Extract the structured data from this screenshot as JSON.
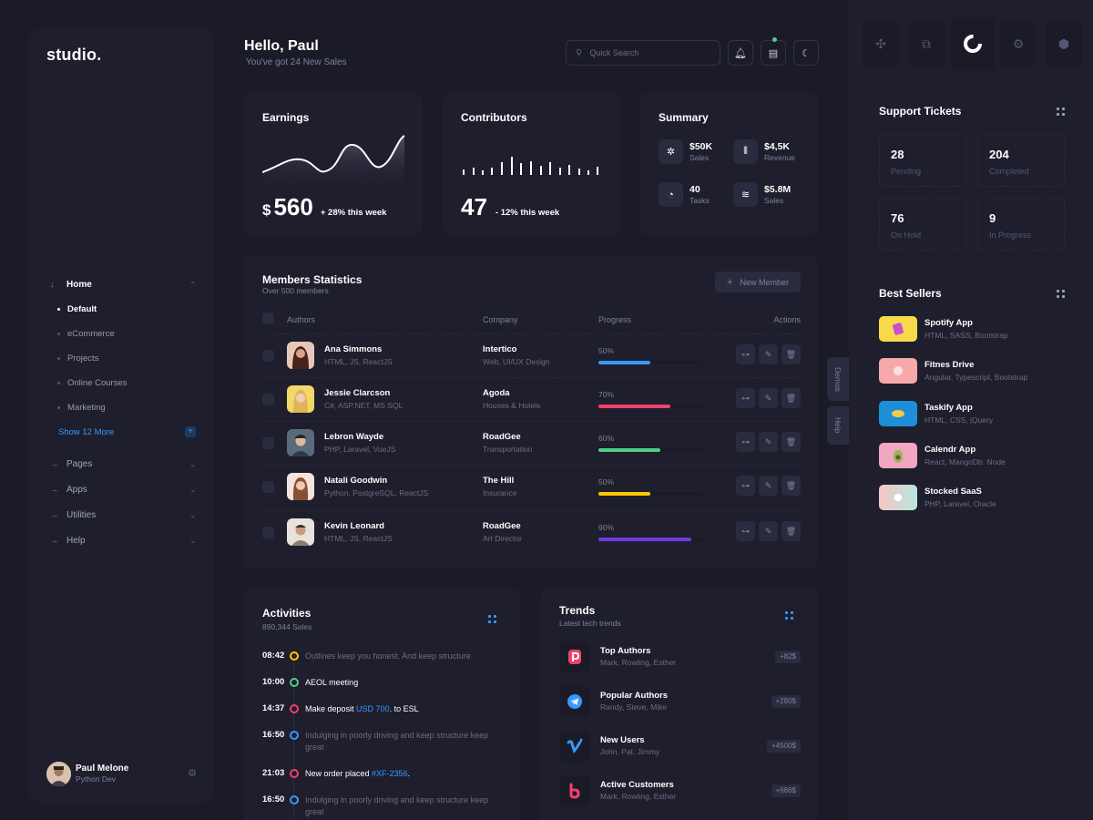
{
  "brand": {
    "logo": "studio."
  },
  "sidebar": {
    "home_label": "Home",
    "home_subitems": [
      "Default",
      "eCommerce",
      "Projects",
      "Online Courses",
      "Marketing"
    ],
    "show_more": "Show 12 More",
    "sections": [
      "Pages",
      "Apps",
      "Utilities",
      "Help"
    ],
    "user": {
      "name": "Paul Melone",
      "role": "Python Dev"
    }
  },
  "header": {
    "greeting": "Hello, Paul",
    "subtitle": "You've got 24 New Sales",
    "search_placeholder": "Quick Search"
  },
  "earnings": {
    "title": "Earnings",
    "currency": "$",
    "value": "560",
    "delta": "+ 28% this week"
  },
  "contributors": {
    "title": "Contributors",
    "value": "47",
    "delta": "- 12% this week"
  },
  "summary": {
    "title": "Summary",
    "items": [
      {
        "value": "$50K",
        "label": "Sales",
        "icon": "spinner-icon"
      },
      {
        "value": "$4,5K",
        "label": "Revenue",
        "icon": "bars-icon"
      },
      {
        "value": "40",
        "label": "Tasks",
        "icon": "refresh-icon"
      },
      {
        "value": "$5.8M",
        "label": "Sales",
        "icon": "stack-icon"
      }
    ]
  },
  "members": {
    "title": "Members Statistics",
    "subtitle": "Over 500 members",
    "new_button": "New Member",
    "columns": [
      "Authors",
      "Company",
      "Progress",
      "Actions"
    ],
    "rows": [
      {
        "name": "Ana Simmons",
        "skills": "HTML, JS, ReactJS",
        "company": "Intertico",
        "company_sub": "Web, UI/UX Design",
        "progress": "50%",
        "progress_value": 0.5,
        "color": "#3699ff"
      },
      {
        "name": "Jessie Clarcson",
        "skills": "C#, ASP.NET, MS SQL",
        "company": "Agoda",
        "company_sub": "Houses & Hotels",
        "progress": "70%",
        "progress_value": 0.7,
        "color": "#f1416c"
      },
      {
        "name": "Lebron Wayde",
        "skills": "PHP, Laravel, VueJS",
        "company": "RoadGee",
        "company_sub": "Transportation",
        "progress": "60%",
        "progress_value": 0.6,
        "color": "#50cd89"
      },
      {
        "name": "Natali Goodwin",
        "skills": "Python, PostgreSQL, ReactJS",
        "company": "The Hill",
        "company_sub": "Insurance",
        "progress": "50%",
        "progress_value": 0.5,
        "color": "#ffc700"
      },
      {
        "name": "Kevin Leonard",
        "skills": "HTML, JS, ReactJS",
        "company": "RoadGee",
        "company_sub": "Art Director",
        "progress": "90%",
        "progress_value": 0.9,
        "color": "#7239ea"
      }
    ]
  },
  "side_tabs": [
    "Demos",
    "Help"
  ],
  "activities": {
    "title": "Activities",
    "subtitle": "890,344 Sales",
    "items": [
      {
        "time": "08:42",
        "text": "Outlines keep you honest. And keep structure",
        "color": "#ffc700",
        "muted": true
      },
      {
        "time": "10:00",
        "text": "AEOL meeting",
        "color": "#50cd89",
        "muted": false
      },
      {
        "time": "14:37",
        "text_before": "Make deposit ",
        "link": "USD 700",
        "text_after": ". to ESL",
        "color": "#f1416c",
        "muted": false
      },
      {
        "time": "16:50",
        "text": "Indulging in poorly driving and keep structure keep great",
        "color": "#3699ff",
        "muted": true
      },
      {
        "time": "21:03",
        "text_before": "New order placed ",
        "link": "#XF-2356",
        "text_after": ".",
        "color": "#f1416c",
        "muted": false
      },
      {
        "time": "16:50",
        "text": "Indulging in poorly driving and keep structure keep great",
        "color": "#3699ff",
        "muted": true
      }
    ]
  },
  "trends": {
    "title": "Trends",
    "subtitle": "Latest tech trends",
    "items": [
      {
        "name": "Top Authors",
        "sub": "Mark, Rowling, Esther",
        "badge": "+82$",
        "icon": "P",
        "icon_color": "#f1416c"
      },
      {
        "name": "Popular Authors",
        "sub": "Randy, Steve, Mike",
        "badge": "+280$",
        "icon": "➤",
        "icon_color": "#3699ff"
      },
      {
        "name": "New Users",
        "sub": "John, Pat, Jimmy",
        "badge": "+4500$",
        "icon": "v",
        "icon_color": "#3699ff"
      },
      {
        "name": "Active Customers",
        "sub": "Mark, Rowling, Esther",
        "badge": "+686$",
        "icon": "b",
        "icon_color": "#f1416c"
      }
    ]
  },
  "support": {
    "title": "Support Tickets",
    "items": [
      {
        "value": "28",
        "label": "Pending"
      },
      {
        "value": "204",
        "label": "Completed"
      },
      {
        "value": "76",
        "label": "On Hold"
      },
      {
        "value": "9",
        "label": "In Progress"
      }
    ]
  },
  "best_sellers": {
    "title": "Best Sellers",
    "items": [
      {
        "name": "Spotify App",
        "sub": "HTML, SASS, Bootstrap",
        "color": "#f7d94c"
      },
      {
        "name": "Fitnes Drive",
        "sub": "Angular, Typescript, Bootstrap",
        "color": "#f7a8a8"
      },
      {
        "name": "Taskify App",
        "sub": "HTML, CSS, jQuery",
        "color": "#1e8fd6"
      },
      {
        "name": "Calendr App",
        "sub": "React, MangoDb. Node",
        "color": "#f2a6c0"
      },
      {
        "name": "Stocked SaaS",
        "sub": "PHP, Laravel, Oracle",
        "color": "#f5c6c6"
      }
    ]
  }
}
